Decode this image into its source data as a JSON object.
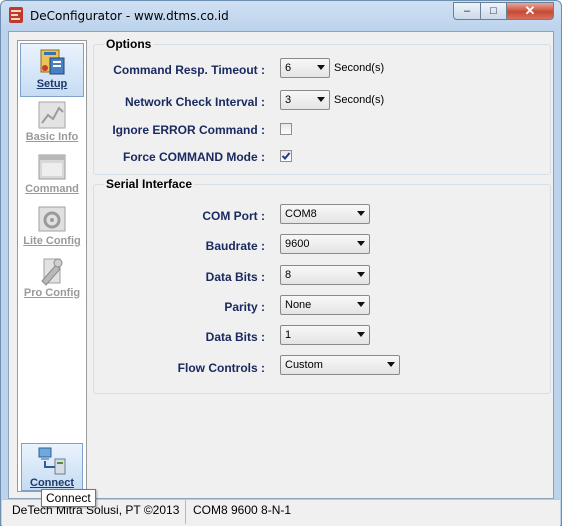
{
  "window": {
    "title": "DeConfigurator - www.dtms.co.id"
  },
  "titlebar_buttons": {
    "minimize": "–",
    "maximize": "□",
    "close": "✕"
  },
  "sidebar": {
    "items": [
      {
        "label": "Setup",
        "icon": "setup-icon",
        "active": true
      },
      {
        "label": "Basic Info",
        "icon": "basic-info-icon",
        "active": false
      },
      {
        "label": "Command",
        "icon": "command-icon",
        "active": false
      },
      {
        "label": "Lite Config",
        "icon": "lite-config-icon",
        "active": false
      },
      {
        "label": "Pro Config",
        "icon": "pro-config-icon",
        "active": false
      }
    ],
    "connect": {
      "label": "Connect",
      "icon": "connect-icon"
    },
    "tooltip": "Connect"
  },
  "options": {
    "title": "Options",
    "resp_timeout": {
      "label": "Command Resp. Timeout :",
      "value": "6",
      "unit": "Second(s)"
    },
    "net_check": {
      "label": "Network Check Interval :",
      "value": "3",
      "unit": "Second(s)"
    },
    "ignore_error": {
      "label": "Ignore ERROR Command :",
      "checked": false
    },
    "force_command": {
      "label": "Force COMMAND Mode :",
      "checked": true
    }
  },
  "serial": {
    "title": "Serial Interface",
    "com_port": {
      "label": "COM Port :",
      "value": "COM8"
    },
    "baudrate": {
      "label": "Baudrate :",
      "value": "9600"
    },
    "data_bits": {
      "label": "Data Bits :",
      "value": "8"
    },
    "parity": {
      "label": "Parity :",
      "value": "None"
    },
    "stop_bits": {
      "label": "Data Bits :",
      "value": "1"
    },
    "flow_controls": {
      "label": "Flow Controls :",
      "value": "Custom"
    }
  },
  "status": {
    "company": "DeTech Mitra Solusi, PT ©2013",
    "connection": "COM8 9600 8-N-1"
  },
  "colors": {
    "accent": "#1a2a60",
    "close_button": "#c74a35",
    "check_mark": "#1e3c8c"
  }
}
